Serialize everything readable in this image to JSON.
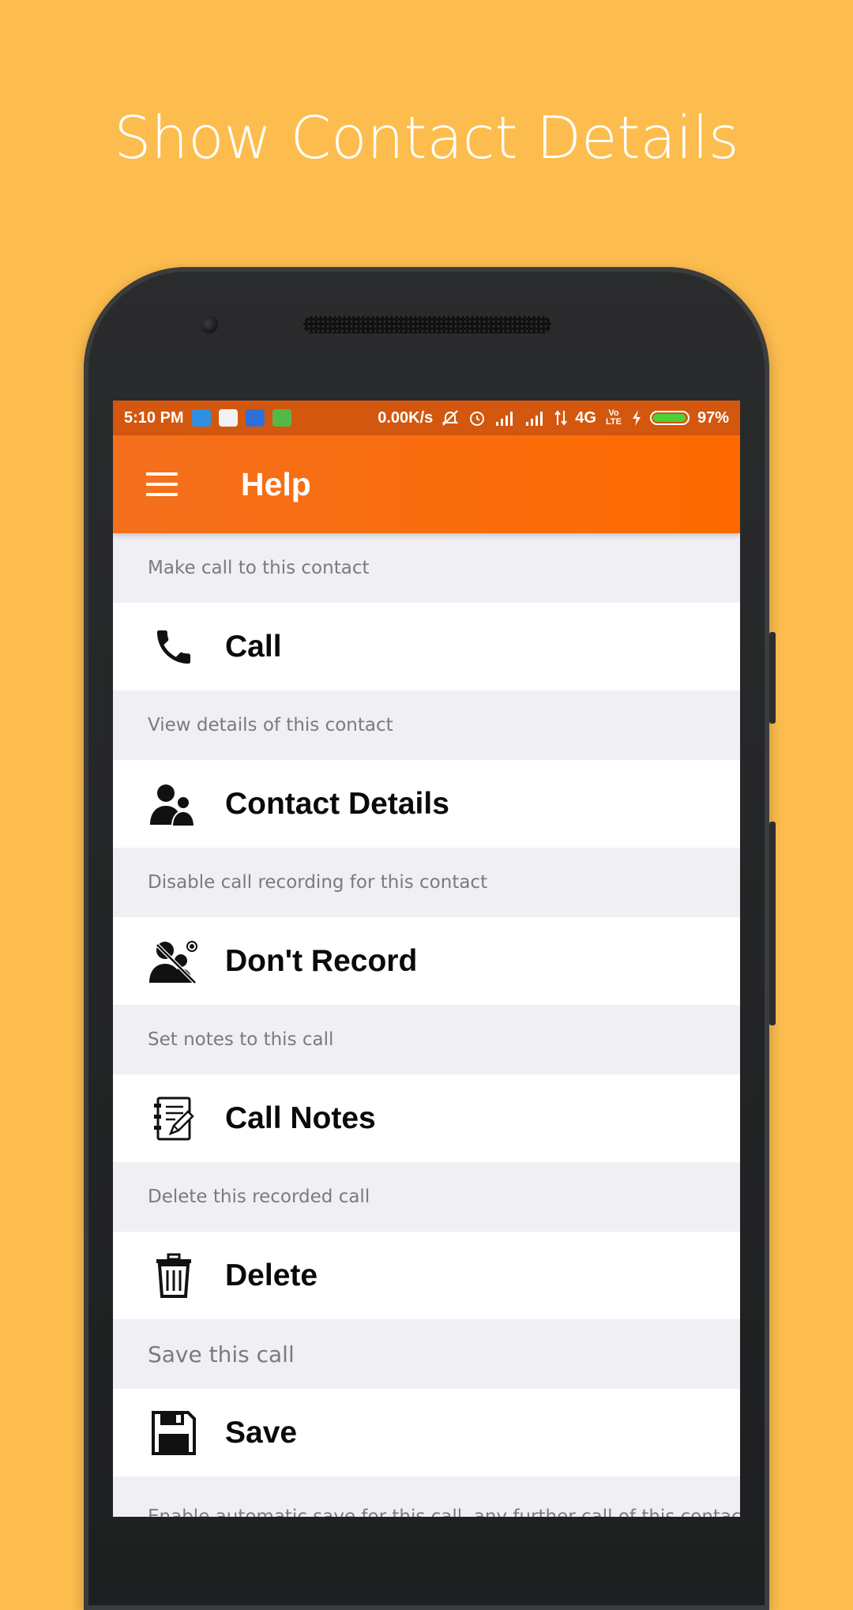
{
  "headline": "Show Contact Details",
  "status_bar": {
    "time": "5:10 PM",
    "speed": "0.00K/s",
    "network": "4G",
    "volte": "Vo LTE",
    "battery": "97%",
    "battery_level": 0.97
  },
  "app_bar": {
    "title": "Help"
  },
  "sections": [
    {
      "description": "Make call to this contact",
      "label": "Call",
      "icon": "phone-icon"
    },
    {
      "description": "View details of this contact",
      "label": "Contact Details",
      "icon": "contacts-icon"
    },
    {
      "description": "Disable call recording for this contact",
      "label": "Don't Record",
      "icon": "no-record-icon"
    },
    {
      "description": "Set notes to this call",
      "label": "Call Notes",
      "icon": "notes-icon"
    },
    {
      "description": "Delete this recorded call",
      "label": "Delete",
      "icon": "trash-icon"
    },
    {
      "description": "Save this call",
      "label": "Save",
      "icon": "floppy-icon"
    }
  ],
  "footer_description": "Enable automatic save for this call, any further call of this contact will be saved",
  "colors": {
    "background": "#fdbd4e",
    "status_bar": "#d3570f",
    "app_bar": "#fe6a00",
    "list_background": "#efeff4"
  }
}
